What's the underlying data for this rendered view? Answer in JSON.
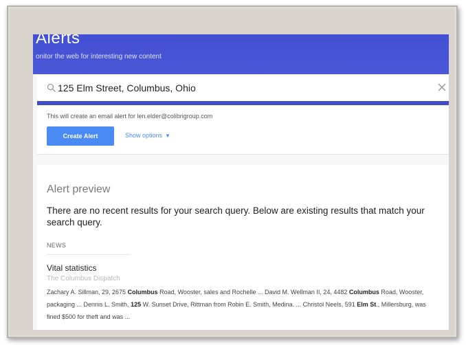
{
  "header": {
    "title": "Alerts",
    "subtitle": "onitor the web for interesting new content"
  },
  "search": {
    "value": "125 Elm Street, Columbus, Ohio",
    "search_icon": "search-icon",
    "clear_icon": "close-icon"
  },
  "create": {
    "email_note": "This will create an email alert for len.elder@colibrigroup.com",
    "button_label": "Create Alert",
    "options_label": "Show options"
  },
  "preview": {
    "title": "Alert preview",
    "message": "There are no recent results for your search query. Below are existing results that match your search query.",
    "section_label": "NEWS",
    "result": {
      "title": "Vital statistics",
      "source": "The Columbus Dispatch",
      "snippet_parts": [
        "Zachary A. Sillman, 29, 2675 ",
        "Columbus",
        " Road, Wooster, sales and Rochelle ... David M. Wellman II, 24, 4482 ",
        "Columbus",
        " Road, Wooster, packaging ... Dennis L. Smith, ",
        "125",
        " W. Sunset Drive, Rittman from Robin E. Smith, Medina. ... Christol Neels, 591 ",
        "Elm St",
        "., Millersburg, was fined $500 for theft and was ..."
      ]
    }
  },
  "colors": {
    "header": "#4553d1",
    "accent": "#4a8af4",
    "frame": "#d8d4cd"
  }
}
